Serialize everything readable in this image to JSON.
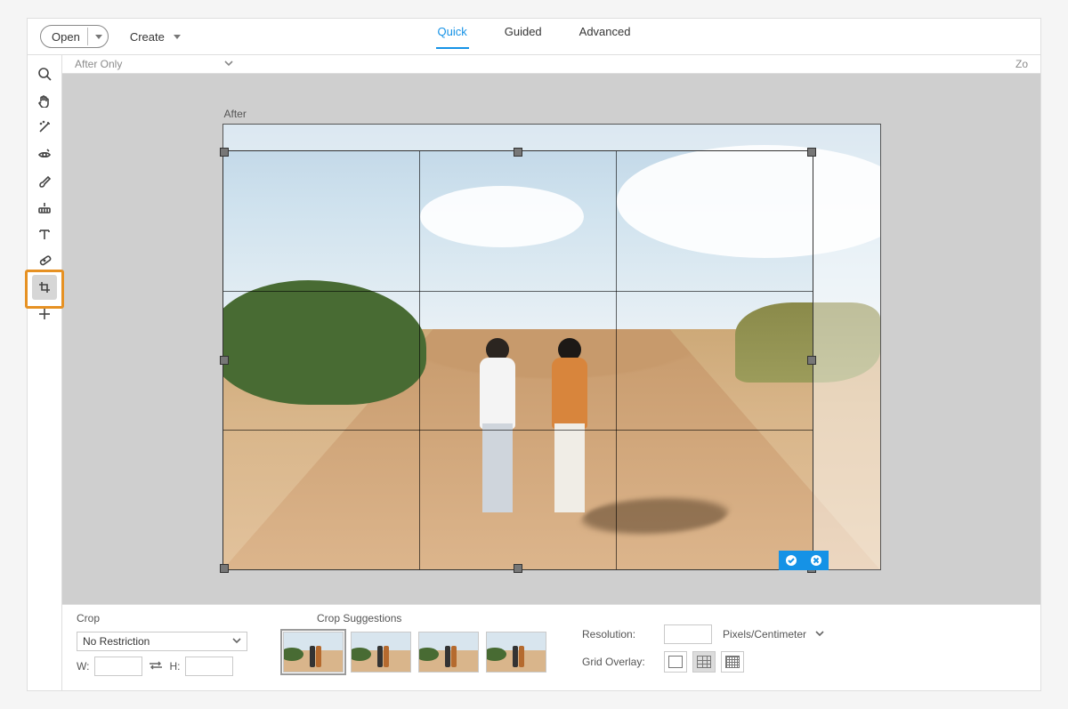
{
  "topbar": {
    "open_label": "Open",
    "create_label": "Create"
  },
  "tabs": {
    "quick": "Quick",
    "guided": "Guided",
    "advanced": "Advanced",
    "active": "quick"
  },
  "viewbar": {
    "mode": "After Only",
    "right": "Zo"
  },
  "tools": [
    {
      "id": "zoom",
      "name": "zoom-tool",
      "icon": "search-icon"
    },
    {
      "id": "hand",
      "name": "hand-tool",
      "icon": "hand-icon"
    },
    {
      "id": "wand",
      "name": "quick-select-tool",
      "icon": "wand-icon"
    },
    {
      "id": "redeye",
      "name": "redeye-tool",
      "icon": "eye-icon"
    },
    {
      "id": "whiten",
      "name": "whiten-tool",
      "icon": "brush-icon"
    },
    {
      "id": "straighten",
      "name": "straighten-tool",
      "icon": "level-icon"
    },
    {
      "id": "text",
      "name": "text-tool",
      "icon": "text-icon"
    },
    {
      "id": "heal",
      "name": "spot-heal-tool",
      "icon": "bandage-icon"
    },
    {
      "id": "crop",
      "name": "crop-tool",
      "icon": "crop-icon",
      "selected": true
    },
    {
      "id": "move",
      "name": "move-tool",
      "icon": "plus-icon"
    }
  ],
  "canvas": {
    "after_label": "After"
  },
  "options": {
    "section_label": "Crop",
    "ratio_select": "No Restriction",
    "w_label": "W:",
    "h_label": "H:",
    "w_value": "",
    "h_value": "",
    "suggestions_label": "Crop Suggestions",
    "resolution_label": "Resolution:",
    "resolution_value": "",
    "units": "Pixels/Centimeter",
    "gridoverlay_label": "Grid Overlay:",
    "selected_overlay": "thirds"
  }
}
